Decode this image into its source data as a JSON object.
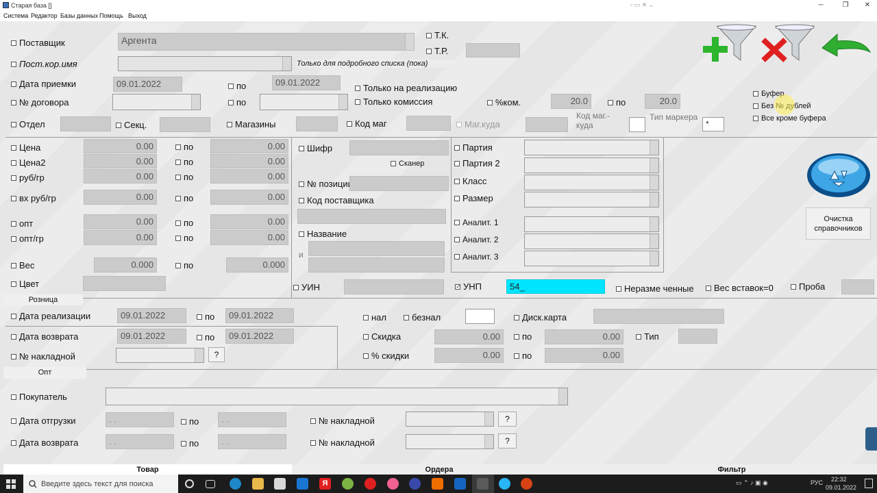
{
  "window": {
    "title": "Старая база []",
    "minimize": "─",
    "maximize": "❐",
    "close": "✕"
  },
  "menu": [
    "Система",
    "Редактор",
    "Базы данных",
    "Помощь",
    "Выход"
  ],
  "supplier": {
    "label": "Поставщик",
    "value": "Аргента",
    "tk": "Т.К.",
    "tr": "Т.Р."
  },
  "post_name": {
    "label": "Пост.кор.имя",
    "note": "Только для подробного списка (пока)"
  },
  "receipt_date": {
    "label": "Дата приемки",
    "from": "09.01.2022",
    "to_label": "по",
    "to": "09.01.2022"
  },
  "contract": {
    "label": "№ договора",
    "to_label": "по"
  },
  "only_sale": "Только на реализацию",
  "only_commission": "Только комиссия",
  "commission": {
    "label": "%ком.",
    "from": "20.0",
    "to_label": "по",
    "to": "20.0"
  },
  "options": {
    "buffer": "Буфер",
    "no_dupes": "Без № дублей",
    "all_but_buffer": "Все кроме буфера"
  },
  "dept": {
    "label": "Отдел",
    "section": "Секц.",
    "shops": "Магазины",
    "shop_code": "Код маг",
    "shop_where": "Маг.куда",
    "shop_code_where": "Код маг.-\nкуда",
    "marker_type": "Тип маркера",
    "marker_value": "*"
  },
  "prices": {
    "to_label": "по",
    "rows": [
      {
        "label": "Цена",
        "from": "0.00",
        "to": "0.00"
      },
      {
        "label": "Цена2",
        "from": "0.00",
        "to": "0.00"
      },
      {
        "label": "руб/гр",
        "from": "0.00",
        "to": "0.00"
      },
      {
        "label": "вх руб/гр",
        "from": "0.00",
        "to": "0.00"
      },
      {
        "label": "опт",
        "from": "0.00",
        "to": "0.00"
      },
      {
        "label": "опт/гр",
        "from": "0.00",
        "to": "0.00"
      }
    ]
  },
  "weight": {
    "label": "Вес",
    "from": "0.000",
    "to_label": "по",
    "to": "0.000"
  },
  "color": {
    "label": "Цвет"
  },
  "middle": {
    "cipher": "Шифр",
    "scanner": "Сканер",
    "position_no": "№ позиции",
    "supplier_code": "Код поставщика",
    "name": "Название",
    "and": "и",
    "uin": "УИН",
    "unp": "УНП",
    "unp_value": "54_"
  },
  "right": {
    "batch": "Партия",
    "batch2": "Партия 2",
    "class": "Класс",
    "size": "Размер",
    "an1": "Аналит. 1",
    "an2": "Аналит. 2",
    "an3": "Аналит. 3"
  },
  "extra": {
    "nonsized": "Неразме ченные",
    "inserts_weight": "Вес вставок=0",
    "sample": "Проба"
  },
  "clear_refs": "Очистка\nсправочников",
  "retail": {
    "title": "Розница",
    "sale_date": {
      "label": "Дата реализации",
      "from": "09.01.2022",
      "to_label": "по",
      "to": "09.01.2022"
    },
    "return_date": {
      "label": "Дата возврата",
      "from": "09.01.2022",
      "to_label": "по",
      "to": "09.01.2022"
    },
    "invoice": {
      "label": "№ накладной",
      "q": "?"
    },
    "cash": "нал",
    "noncash": "безнал",
    "disc_card": "Диск.карта",
    "discount": {
      "label": "Скидка",
      "from": "0.00",
      "to_label": "по",
      "to": "0.00",
      "type": "Тип"
    },
    "discount_pct": {
      "label": "% скидки",
      "from": "0.00",
      "to_label": "по",
      "to": "0.00"
    }
  },
  "wholesale": {
    "title": "Опт",
    "buyer": "Покупатель",
    "ship_date": {
      "label": "Дата отгрузки",
      "from": ". .",
      "to_label": "по",
      "to": ". .",
      "invoice": "№ накладной",
      "q": "?"
    },
    "return_date": {
      "label": "Дата возврата",
      "from": ". .",
      "to_label": "по",
      "to": ". .",
      "invoice": "№ накладной",
      "q": "?"
    }
  },
  "tabs": [
    "Товар",
    "Ордера",
    "Фильтр"
  ],
  "taskbar": {
    "search_placeholder": "Введите здесь текст для поиска",
    "lang": "РУС",
    "time": "22:32",
    "date": "09.01.2022"
  },
  "colors": {
    "unp_field": "#00e5ff",
    "form_bg": "#e6e6e6",
    "field_bg": "#cbcbcb"
  }
}
